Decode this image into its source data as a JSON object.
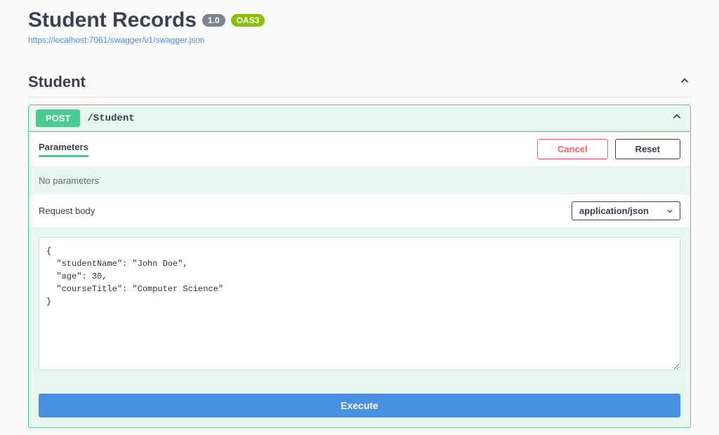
{
  "header": {
    "title": "Student Records",
    "version": "1.0",
    "oas_label": "OAS3",
    "url": "https://localhost:7061/swagger/v1/swagger.json"
  },
  "tag": {
    "name": "Student"
  },
  "operation": {
    "method": "POST",
    "path": "/Student"
  },
  "parameters": {
    "title": "Parameters",
    "cancel_label": "Cancel",
    "reset_label": "Reset",
    "empty_text": "No parameters"
  },
  "request_body": {
    "title": "Request body",
    "content_type": "application/json",
    "value": "{\n  \"studentName\": \"John Doe\",\n  \"age\": 30,\n  \"courseTitle\": \"Computer Science\"\n}"
  },
  "execute": {
    "label": "Execute"
  }
}
